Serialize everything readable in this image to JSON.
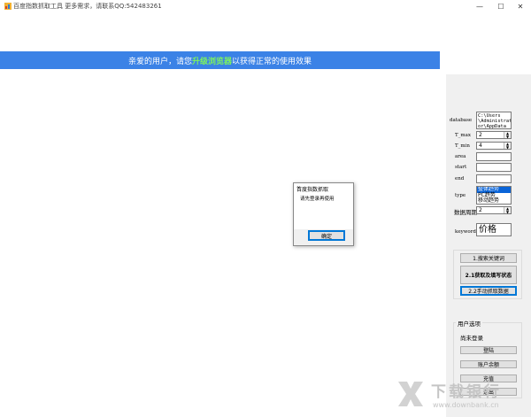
{
  "window": {
    "title": "百度指数抓取工具  更多需求，请联系QQ:542483261",
    "controls": {
      "minimize": "—",
      "maximize": "☐",
      "close": "✕"
    }
  },
  "banner": {
    "prefix": "亲爱的用户，请您",
    "highlight": "升级浏览器",
    "suffix": "以获得正常的使用效果",
    "colors": {
      "background": "#3b82e6",
      "highlight": "#7df35e"
    }
  },
  "form": {
    "database_label": "database",
    "database_value": "C:\\Users\n\\Administrat\nor\\AppData",
    "t_max_label": "T_max",
    "t_max_value": "2",
    "t_min_label": "T_min",
    "t_min_value": "4",
    "area_label": "area",
    "area_value": "",
    "start_label": "start",
    "start_value": "",
    "end_label": "end",
    "end_value": "",
    "type_label": "type",
    "type_options": [
      "整体趋势",
      "PC趋势",
      "移动趋势"
    ],
    "period_label": "数据周期",
    "period_value": "2",
    "keyword_label": "keyword:",
    "keyword_value": "价格"
  },
  "actions": {
    "search_keywords": "1.搜索关键词",
    "get_status": "2.1获取及填写状态",
    "manual_fetch": "2.2手动抓取数据"
  },
  "user_options": {
    "title": "用户选项",
    "status": "尚未登录",
    "login": "登陆",
    "balance": "账户余额",
    "recharge": "充值",
    "logout": "退出"
  },
  "dialog": {
    "title": "百度指数抓取",
    "message": "请先登录再使用",
    "ok": "确定"
  },
  "watermark": {
    "text": "下载银行",
    "url": "www.downbank.cn"
  }
}
